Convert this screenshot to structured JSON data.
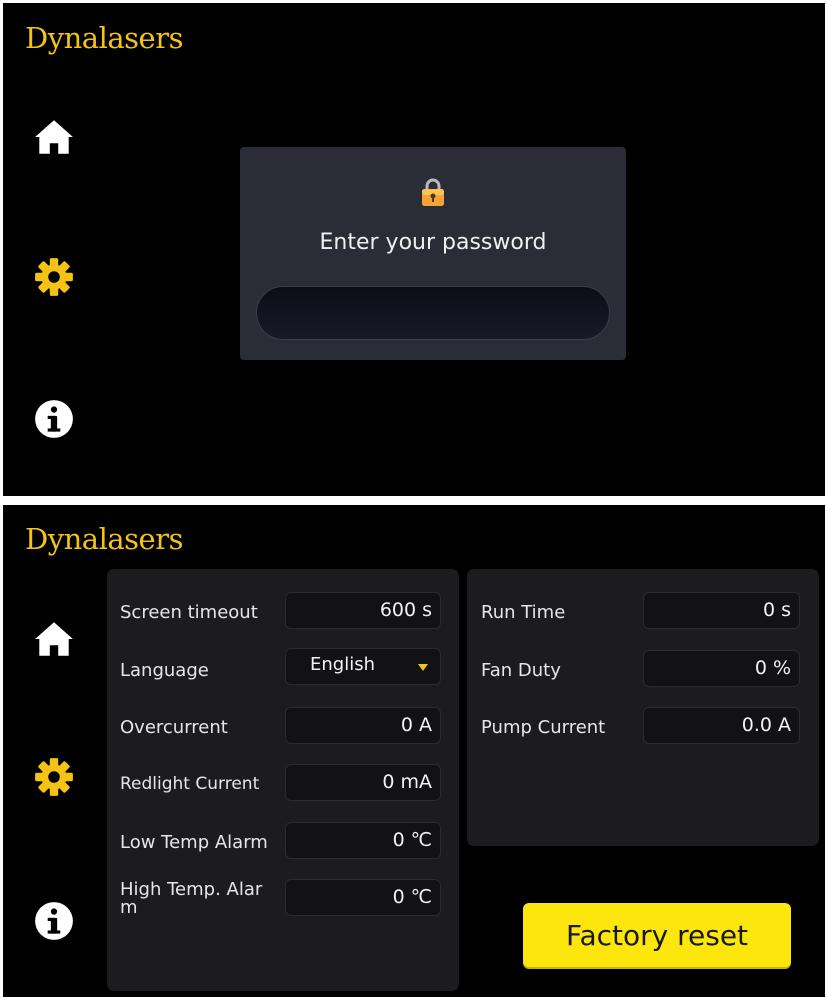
{
  "brand": {
    "logo_text": "Dynalasers",
    "accent": "#f4c316"
  },
  "nav": {
    "items": [
      {
        "icon": "home-icon"
      },
      {
        "icon": "gear-icon"
      },
      {
        "icon": "info-icon"
      }
    ]
  },
  "login": {
    "lock_icon": "lock-icon",
    "title": "Enter your password",
    "password_value": ""
  },
  "settings": {
    "left": [
      {
        "label": "Screen timeout",
        "value": "600",
        "unit": "s"
      },
      {
        "label": "Language",
        "value": "English",
        "type": "dropdown"
      },
      {
        "label": "Overcurrent",
        "value": "0",
        "unit": "A"
      },
      {
        "label": "Redlight Current",
        "value": "0",
        "unit": "mA"
      },
      {
        "label": "Low Temp Alarm",
        "value": "0",
        "unit": "℃"
      },
      {
        "label": "High Temp. Alar\nm",
        "value": "0",
        "unit": "℃"
      }
    ],
    "right": [
      {
        "label": "Run Time",
        "value": "0",
        "unit": "s"
      },
      {
        "label": "Fan Duty",
        "value": "0",
        "unit": "%"
      },
      {
        "label": "Pump Current",
        "value": "0.0",
        "unit": "A"
      }
    ],
    "reset_label": "Factory reset",
    "reset_color": "#fde60c"
  }
}
